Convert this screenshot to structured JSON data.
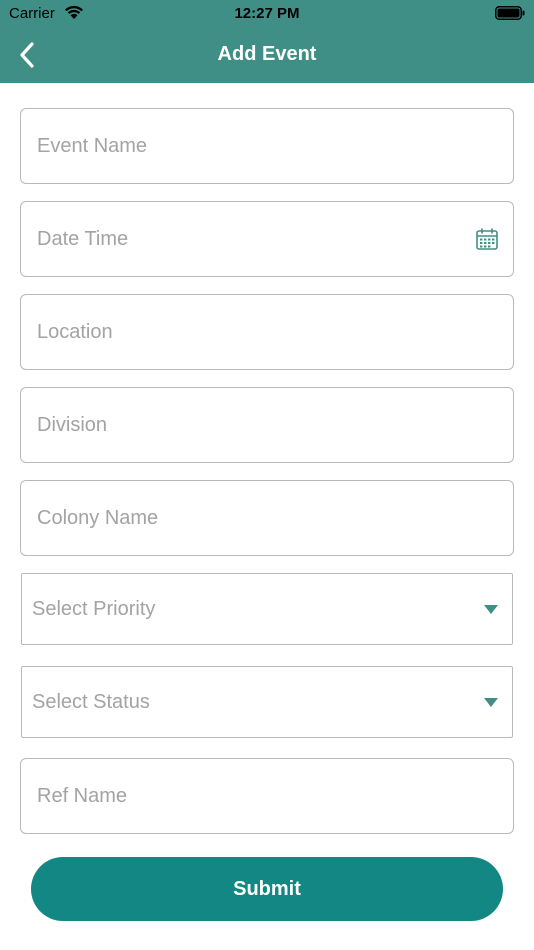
{
  "status_bar": {
    "carrier": "Carrier",
    "time": "12:27 PM"
  },
  "nav": {
    "title": "Add Event",
    "back_icon": "chevron-left-icon"
  },
  "form": {
    "event_name": {
      "placeholder": "Event Name",
      "value": ""
    },
    "date_time": {
      "placeholder": "Date Time",
      "value": "",
      "icon": "calendar-icon"
    },
    "location": {
      "placeholder": "Location",
      "value": ""
    },
    "division": {
      "placeholder": "Division",
      "value": ""
    },
    "colony_name": {
      "placeholder": "Colony Name",
      "value": ""
    },
    "priority": {
      "selected": "Select Priority",
      "icon": "dropdown-arrow-icon"
    },
    "status": {
      "selected": "Select Status",
      "icon": "dropdown-arrow-icon"
    },
    "ref_name": {
      "placeholder": "Ref Name",
      "value": ""
    }
  },
  "submit_label": "Submit",
  "colors": {
    "header": "#3f8f86",
    "accent": "#138783",
    "border": "#b9b9b9",
    "placeholder": "#a3a3a3"
  }
}
